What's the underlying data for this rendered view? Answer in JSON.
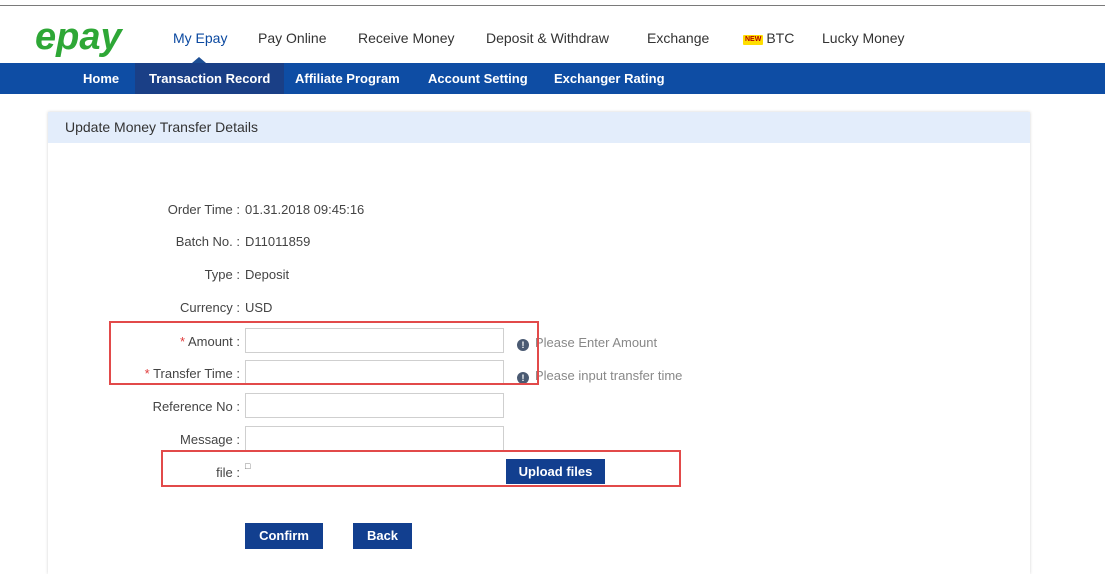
{
  "brand": {
    "logo_text": "epay",
    "logo_color": "#2ea736",
    "accent": "#0e4da4"
  },
  "topnav": {
    "items": [
      {
        "label": "My Epay"
      },
      {
        "label": "Pay Online"
      },
      {
        "label": "Receive Money"
      },
      {
        "label": "Deposit & Withdraw"
      },
      {
        "label": "Exchange"
      },
      {
        "label": "BTC",
        "badge": "NEW"
      },
      {
        "label": "Lucky Money"
      }
    ]
  },
  "subnav": {
    "items": [
      {
        "label": "Home"
      },
      {
        "label": "Transaction Record"
      },
      {
        "label": "Affiliate Program"
      },
      {
        "label": "Account Setting"
      },
      {
        "label": "Exchanger Rating"
      }
    ]
  },
  "panel": {
    "title": "Update Money Transfer Details",
    "fields": {
      "order_time": {
        "label": "Order Time :",
        "value": "01.31.2018 09:45:16"
      },
      "batch_no": {
        "label": "Batch No. :",
        "value": "D11011859"
      },
      "type": {
        "label": "Type :",
        "value": "Deposit"
      },
      "currency": {
        "label": "Currency :",
        "value": "USD"
      },
      "amount": {
        "required_mark": "*",
        "label": "Amount :",
        "value": "",
        "hint": "Please Enter Amount"
      },
      "transfer_time": {
        "required_mark": "*",
        "label": "Transfer Time :",
        "value": "",
        "hint": "Please input transfer time"
      },
      "reference_no": {
        "label": "Reference No :",
        "value": ""
      },
      "message": {
        "label": "Message :",
        "value": ""
      },
      "file": {
        "label": "file :",
        "value": "□",
        "upload_label": "Upload files"
      }
    },
    "buttons": {
      "confirm": "Confirm",
      "back": "Back"
    }
  },
  "icons": {
    "info": "info-icon"
  }
}
